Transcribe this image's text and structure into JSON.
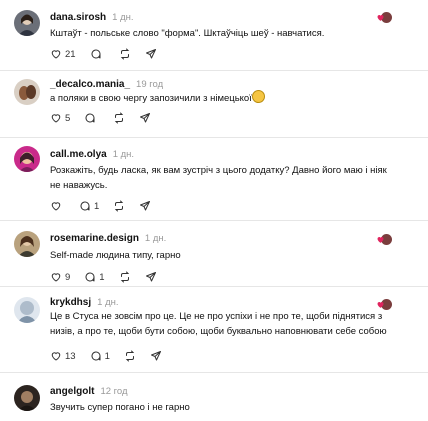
{
  "comments": [
    {
      "username": "dana.sirosh",
      "time": "1 дн.",
      "text": "Кштаўт - польське слово \"форма\". Шктаўчіць шеў - навчатися.",
      "likes": "21",
      "replies": "",
      "has_badge": true
    },
    {
      "username": "_decalco.mania_",
      "time": "19 год",
      "text": "а поляки в свою чергу запозичили з німецької",
      "likes": "5",
      "replies": "",
      "has_badge": false,
      "emoji": "smiling-face"
    },
    {
      "username": "call.me.olya",
      "time": "1 дн.",
      "text": "Розкажіть, будь ласка, як вам зустріч з цього додатку? Давно його маю і ніяк не наважусь.",
      "likes": "",
      "replies": "1",
      "has_badge": false
    },
    {
      "username": "rosemarine.design",
      "time": "1 дн.",
      "text": "Self-made людина типу, гарно",
      "likes": "9",
      "replies": "1",
      "has_badge": true
    },
    {
      "username": "krykdhsj",
      "time": "1 дн.",
      "text": "Це в Стуса не зовсім про це. Це не про успіхи і не про те, щоби піднятися з низів, а про те, щоби бути собою, щоби буквально наповнювати себе собою",
      "likes": "13",
      "replies": "1",
      "has_badge": true
    },
    {
      "username": "angelgolt",
      "time": "12 год",
      "text": "Звучить супер погано і не гарно",
      "likes": "",
      "replies": "",
      "has_badge": false
    }
  ],
  "colors": {
    "heart": "#e0245e",
    "divider": "#e6e6e6",
    "muted": "#9a9a9a"
  },
  "icons": [
    "heart-outline-icon",
    "comment-bubble-icon",
    "repost-icon",
    "share-icon",
    "liked-by-author-badge"
  ]
}
